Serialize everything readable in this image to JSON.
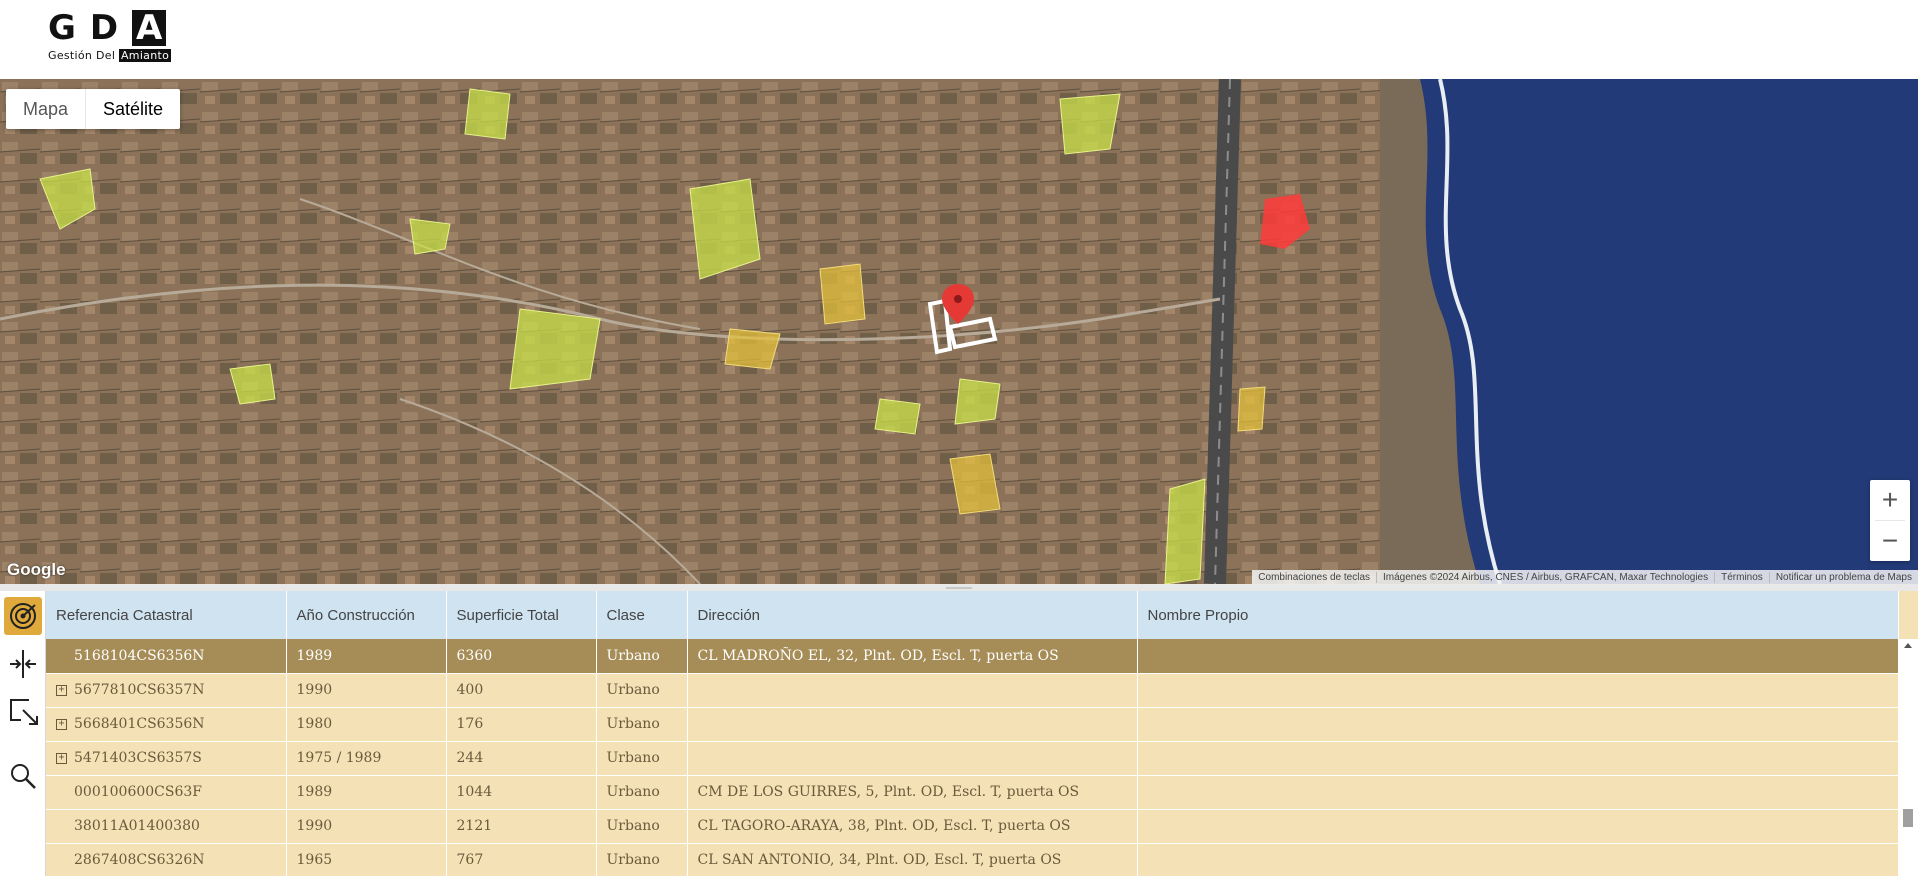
{
  "logo": {
    "letters": [
      "G",
      "D",
      "A"
    ],
    "tagline_prefix": "Gestión Del",
    "tagline_highlight": "Amianto"
  },
  "map": {
    "map_types": [
      {
        "label": "Mapa",
        "active": false
      },
      {
        "label": "Satélite",
        "active": true
      }
    ],
    "zoom_in": "+",
    "zoom_out": "−",
    "google_label": "Google",
    "attribution": [
      "Combinaciones de teclas",
      "Imágenes ©2024 Airbus, CNES / Airbus, GRAFCAN, Maxar Technologies",
      "Términos",
      "Notificar un problema de Maps"
    ],
    "colors": {
      "parcel_fill": "#c8e04a",
      "parcel_yellow": "#e8c33a",
      "parcel_highlight": "#ff3b3b",
      "marker": "#e53935",
      "sea": "#233a78"
    }
  },
  "grid": {
    "columns": [
      "Referencia Catastral",
      "Año Construcción",
      "Superficie Total",
      "Clase",
      "Dirección",
      "Nombre Propio"
    ],
    "rows": [
      {
        "ref": "5168104CS6356N",
        "year": "1989",
        "surface": "6360",
        "class": "Urbano",
        "address": "CL MADROÑO EL, 32, Plnt. OD, Escl. T, puerta OS",
        "name": "",
        "expandable": false,
        "selected": true
      },
      {
        "ref": "5677810CS6357N",
        "year": "1990",
        "surface": "400",
        "class": "Urbano",
        "address": "",
        "name": "",
        "expandable": true,
        "selected": false
      },
      {
        "ref": "5668401CS6356N",
        "year": "1980",
        "surface": "176",
        "class": "Urbano",
        "address": "",
        "name": "",
        "expandable": true,
        "selected": false
      },
      {
        "ref": "5471403CS6357S",
        "year": "1975 / 1989",
        "surface": "244",
        "class": "Urbano",
        "address": "",
        "name": "",
        "expandable": true,
        "selected": false
      },
      {
        "ref": "000100600CS63F",
        "year": "1989",
        "surface": "1044",
        "class": "Urbano",
        "address": "CM DE LOS GUIRRES, 5, Plnt. OD, Escl. T, puerta OS",
        "name": "",
        "expandable": false,
        "selected": false
      },
      {
        "ref": "38011A01400380",
        "year": "1990",
        "surface": "2121",
        "class": "Urbano",
        "address": "CL TAGORO-ARAYA, 38, Plnt. OD, Escl. T, puerta OS",
        "name": "",
        "expandable": false,
        "selected": false
      },
      {
        "ref": "2867408CS6326N",
        "year": "1965",
        "surface": "767",
        "class": "Urbano",
        "address": "CL SAN ANTONIO, 34, Plnt. OD, Escl. T, puerta OS",
        "name": "",
        "expandable": false,
        "selected": false
      }
    ],
    "expander_symbol": "+"
  },
  "toolbar": {
    "tools": [
      "target-icon",
      "split-icon",
      "expand-select-icon",
      "search-icon"
    ]
  }
}
